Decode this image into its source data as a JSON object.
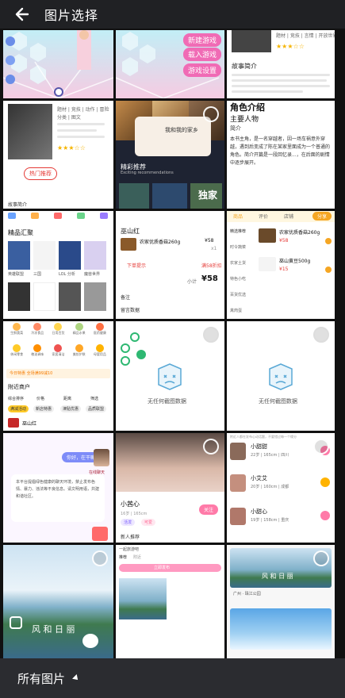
{
  "header": {
    "title": "图片选择"
  },
  "footer": {
    "album_label": "所有图片"
  },
  "tiles": {
    "t1": {
      "tags": [
        "新建游戏",
        "载入游戏",
        "游戏设置"
      ]
    },
    "t3": {
      "meta": "题材 | 竞技 | 言情 | 开放世界",
      "intro_title": "故事简介"
    },
    "t4": {
      "labels": [
        "题材 | 竞技 | 动作 | 冒险",
        "分类 | 图文"
      ],
      "tag": "热门推荐",
      "footer": "故事简介"
    },
    "t5": {
      "title": "我和我的家乡",
      "subtitle": "精彩推荐",
      "sub2": "Exciting recommendations",
      "badge": "独家"
    },
    "t6": {
      "heading": "角色介绍",
      "subheading": "主要人物",
      "section": "简介",
      "body": "本书主角，是一名穿越者，因一场车祸意外穿越，遇到后变成了陈在某家里面成为一个普通的角色。简介开篇是一段回忆录...，在后面的剧情中逐步展开。"
    },
    "t7": {
      "section": "精品汇聚",
      "games": [
        "英雄联盟",
        "三国",
        "LOL 分析",
        "魔兽世界"
      ]
    },
    "t8": {
      "shop": "巫山红",
      "product": "农家优质香菇260g",
      "price": "¥58",
      "qty": "x1",
      "order_btn": "下单提示",
      "coupon": "满58折扣",
      "total_label": "小计",
      "total": "¥58",
      "row1": "备注",
      "row2": "留言数据"
    },
    "t9": {
      "tabs": [
        "商品",
        "评价",
        "店铺"
      ],
      "btn": "分享",
      "cats": [
        "精选推荐",
        "时令蔬菜",
        "农家土货",
        "特色小吃",
        "百货优选",
        "禽肉蛋"
      ],
      "items": [
        {
          "name": "农家优质香菇260g",
          "price": "¥58"
        },
        {
          "name": "巫山黄豆500g",
          "price": "¥15"
        }
      ]
    },
    "t10": {
      "categories": [
        "生鲜蔬菜",
        "冷冻食品",
        "日用百货",
        "精品水果",
        "医药健康",
        "休闲零食",
        "粮油调味",
        "家居清洁",
        "美妆护肤",
        "母婴用品"
      ],
      "notice": "今日特惠 全场满99减10",
      "section": "附近商户",
      "filters": [
        "综合排序",
        "价格",
        "距离",
        "筛选"
      ],
      "chips": [
        "满减活动",
        "新店特惠",
        "津贴优惠",
        "品质联盟"
      ],
      "shop": "巫山红"
    },
    "t11": {
      "empty_text": "无任何截图数据"
    },
    "t12": {
      "empty_text": "无任何截图数据"
    },
    "t13": {
      "bubble": "你好，在干嘛",
      "tag": "在线聊天",
      "body": "本平台提倡绿色健康的聊天环境，禁止发布色情、暴力、违法等不良信息。请文明用语，共建和谐社区。"
    },
    "t14": {
      "name": "小茜心",
      "meta": "16岁 | 165cm",
      "btn": "关注",
      "tags": [
        "活泼",
        "可爱"
      ],
      "footer": "新人推荐"
    },
    "t15": {
      "header": "附近人都在发布心动话题，不要错过每一个缘分",
      "users": [
        {
          "name": "小甜甜",
          "meta": "22岁 | 165cm | 四川"
        },
        {
          "name": "小艾艾",
          "meta": "20岁 | 160cm | 成都"
        },
        {
          "name": "小甜心",
          "meta": "19岁 | 158cm | 重庆"
        }
      ]
    },
    "t16": {
      "text": "风 和 日 丽"
    },
    "t17": {
      "header": "一起旅游吧",
      "tabs": [
        "推荐",
        "附近"
      ],
      "btn": "立即发布"
    },
    "t18": {
      "text": "风 和 日 丽",
      "location": "广州 · 珠江公园"
    }
  },
  "colors": {
    "accent": "#f5a623",
    "brand_red": "#e53935",
    "pink": "#ff7aa8"
  }
}
